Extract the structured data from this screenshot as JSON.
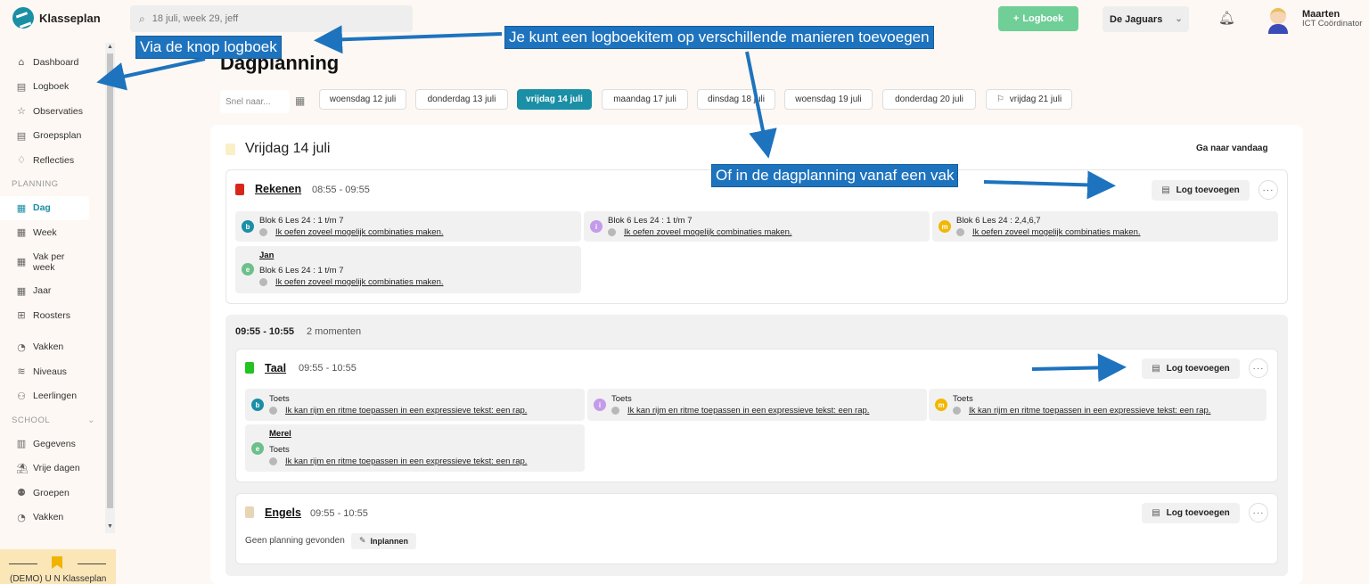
{
  "app": {
    "name": "Klasseplan"
  },
  "search": {
    "placeholder": "18 juli, week 29, jeff"
  },
  "header": {
    "logboek_button": "Logboek",
    "team": "De Jaguars",
    "user_name": "Maarten",
    "user_role": "ICT Coördinator"
  },
  "sidebar": {
    "items": [
      {
        "label": "Dashboard",
        "icon": "home-icon"
      },
      {
        "label": "Logboek",
        "icon": "book-icon"
      },
      {
        "label": "Observaties",
        "icon": "star-icon"
      },
      {
        "label": "Groepsplan",
        "icon": "document-icon"
      },
      {
        "label": "Reflecties",
        "icon": "lightbulb-icon"
      }
    ],
    "planning_label": "PLANNING",
    "planning_items": [
      {
        "label": "Dag",
        "icon": "calendar-icon",
        "active": true
      },
      {
        "label": "Week",
        "icon": "calendar-icon"
      },
      {
        "label": "Vak per week",
        "icon": "calendar-icon"
      },
      {
        "label": "Jaar",
        "icon": "calendar-icon"
      },
      {
        "label": "Roosters",
        "icon": "grid-icon"
      }
    ],
    "other_items": [
      {
        "label": "Vakken",
        "icon": "shapes-icon"
      },
      {
        "label": "Niveaus",
        "icon": "layers-icon"
      },
      {
        "label": "Leerlingen",
        "icon": "students-icon"
      }
    ],
    "school_label": "SCHOOL",
    "school_items": [
      {
        "label": "Gegevens",
        "icon": "building-icon"
      },
      {
        "label": "Vrije dagen",
        "icon": "beach-icon"
      },
      {
        "label": "Groepen",
        "icon": "group-icon"
      },
      {
        "label": "Vakken",
        "icon": "shapes-icon"
      }
    ],
    "demo": "(DEMO) U N Klasseplan"
  },
  "page": {
    "title": "Dagplanning",
    "quick_placeholder": "Snel naar...",
    "dates": [
      {
        "label": "woensdag 12 juli"
      },
      {
        "label": "donderdag 13 juli"
      },
      {
        "label": "vrijdag 14 juli",
        "active": true
      },
      {
        "label": "maandag 17 juli"
      },
      {
        "label": "dinsdag 18 juli"
      },
      {
        "label": "woensdag 19 juli"
      },
      {
        "label": "donderdag 20 juli"
      },
      {
        "label": "vrijdag 21 juli",
        "icon": "flag-icon"
      }
    ],
    "day_title": "Vrijdag 14 juli",
    "today_link": "Ga naar vandaag",
    "log_button": "Log toevoegen",
    "more": "···"
  },
  "lessons": {
    "rekenen": {
      "name": "Rekenen",
      "time": "08:55 - 09:55",
      "color": "#d9261c",
      "goals": [
        {
          "level": "b",
          "title": "Blok 6 Les 24 : 1 t/m 7",
          "text": "Ik oefen zoveel mogelijk combinaties maken."
        },
        {
          "level": "i",
          "title": "Blok 6 Les 24 : 1 t/m 7",
          "text": "Ik oefen zoveel mogelijk combinaties maken."
        },
        {
          "level": "m",
          "title": "Blok 6 Les 24 : 2,4,6,7",
          "text": "Ik oefen zoveel mogelijk combinaties maken."
        },
        {
          "level": "e",
          "name": "Jan",
          "title": "Blok 6 Les 24 : 1 t/m 7",
          "text": "Ik oefen zoveel mogelijk combinaties maken."
        }
      ]
    },
    "block": {
      "time": "09:55 - 10:55",
      "count": "2 momenten"
    },
    "taal": {
      "name": "Taal",
      "time": "09:55 - 10:55",
      "color": "#22c322",
      "goals": [
        {
          "level": "b",
          "title": "Toets",
          "text": "Ik kan rijm en ritme toepassen in een expressieve tekst: een rap."
        },
        {
          "level": "i",
          "title": "Toets",
          "text": "Ik kan rijm en ritme toepassen in een expressieve tekst: een rap."
        },
        {
          "level": "m",
          "title": "Toets",
          "text": "Ik kan rijm en ritme toepassen in een expressieve tekst: een rap."
        },
        {
          "level": "e",
          "name": "Merel",
          "title": "Toets",
          "text": "Ik kan rijm en ritme toepassen in een expressieve tekst: een rap."
        }
      ]
    },
    "engels": {
      "name": "Engels",
      "time": "09:55 - 10:55",
      "color": "#e8d5b5",
      "no_plan": "Geen planning gevonden",
      "plan_button": "Inplannen"
    }
  },
  "level_colors": {
    "b": "#1a8fa6",
    "i": "#c49bea",
    "m": "#f2b705",
    "e": "#6cc08b"
  },
  "annotations": {
    "main": "Je kunt een logboekitem op verschillende manieren toevoegen",
    "via_button": "Via de knop logboek",
    "via_planning": "Of in de dagplanning vanaf een vak"
  }
}
